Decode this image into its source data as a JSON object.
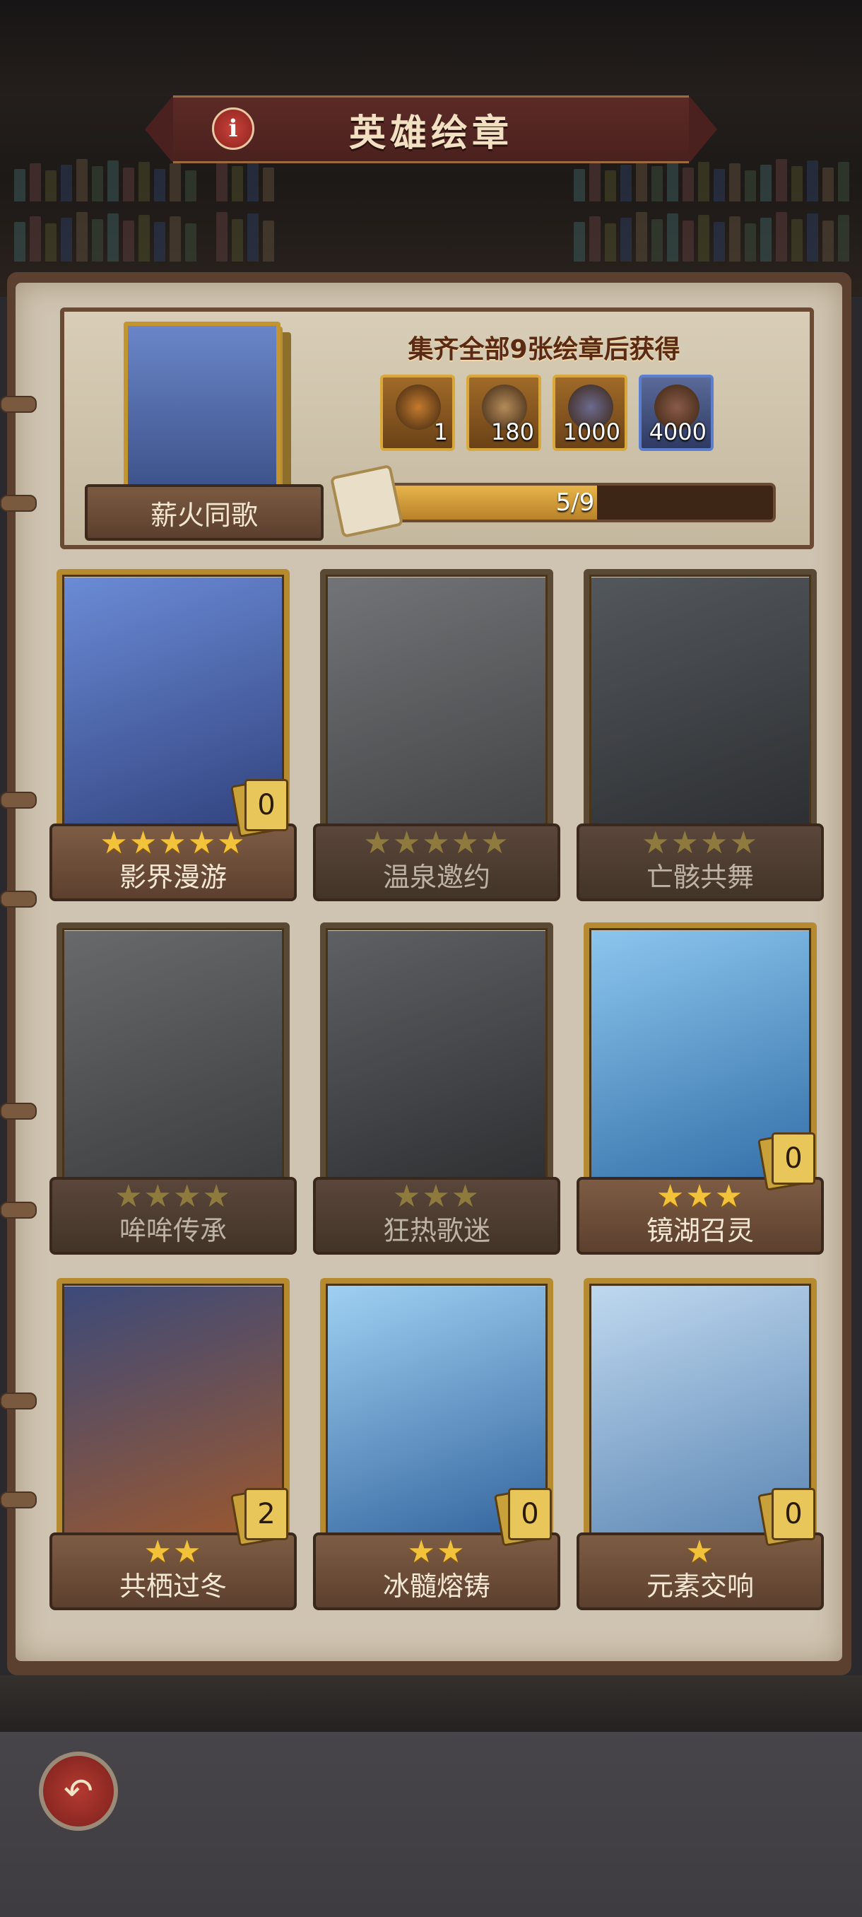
{
  "header": {
    "title": "英雄绘章",
    "info_icon": "info-icon"
  },
  "reward": {
    "title": "集齐全部9张绘章后获得",
    "set_name": "薪火同歌",
    "items": [
      {
        "icon": "pouch-icon",
        "qty": "1",
        "color": "#c47a2e"
      },
      {
        "icon": "scroll-icon",
        "qty": "180",
        "color": "#b58b5a"
      },
      {
        "icon": "ore-icon",
        "qty": "1000",
        "color": "#6d6a8f"
      },
      {
        "icon": "crystal-ore-icon",
        "qty": "4000",
        "color": "#8a5a4a"
      }
    ],
    "progress_text": "5/9",
    "progress": 0.5556
  },
  "cards": [
    {
      "name": "影界漫游",
      "stars_on": 5,
      "stars_total": 5,
      "count": "0",
      "locked": false,
      "color1": "#6b8bd6",
      "color2": "#2e3f7a"
    },
    {
      "name": "温泉邀约",
      "stars_on": 0,
      "stars_total": 5,
      "count": "",
      "locked": true,
      "color1": "#a7b3c2",
      "color2": "#5d6670"
    },
    {
      "name": "亡骸共舞",
      "stars_on": 0,
      "stars_total": 4,
      "count": "",
      "locked": true,
      "color1": "#6d8aa8",
      "color2": "#3a4658"
    },
    {
      "name": "哞哞传承",
      "stars_on": 0,
      "stars_total": 4,
      "count": "",
      "locked": true,
      "color1": "#9aa3ae",
      "color2": "#555b63"
    },
    {
      "name": "狂热歌迷",
      "stars_on": 0,
      "stars_total": 3,
      "count": "",
      "locked": true,
      "color1": "#8a94a6",
      "color2": "#3f4652"
    },
    {
      "name": "镜湖召灵",
      "stars_on": 3,
      "stars_total": 3,
      "count": "0",
      "locked": false,
      "color1": "#8cc6ee",
      "color2": "#2f6aa4"
    },
    {
      "name": "共栖过冬",
      "stars_on": 2,
      "stars_total": 2,
      "count": "2",
      "locked": false,
      "color1": "#3c4a7a",
      "color2": "#a0582a"
    },
    {
      "name": "冰髓熔铸",
      "stars_on": 2,
      "stars_total": 2,
      "count": "0",
      "locked": false,
      "color1": "#9fd0f2",
      "color2": "#2d5f9a"
    },
    {
      "name": "元素交响",
      "stars_on": 1,
      "stars_total": 1,
      "count": "0",
      "locked": false,
      "color1": "#bfd8ef",
      "color2": "#5682b0"
    }
  ],
  "footer": {
    "back_icon": "back-arrow-icon"
  }
}
